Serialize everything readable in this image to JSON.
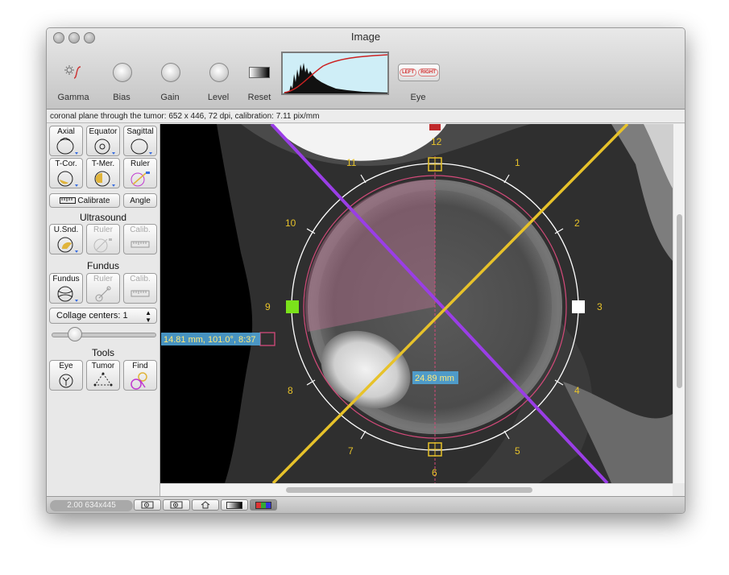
{
  "window": {
    "title": "Image"
  },
  "toolbar": {
    "gamma_label": "Gamma",
    "bias_label": "Bias",
    "gain_label": "Gain",
    "level_label": "Level",
    "reset_label": "Reset",
    "eye_label": "Eye",
    "eye_left": "LEFT",
    "eye_right": "RIGHT"
  },
  "info": {
    "text": "coronal plane through the tumor: 652 x 446, 72 dpi, calibration: 7.11 pix/mm"
  },
  "sidebar": {
    "axial": "Axial",
    "equator": "Equator",
    "sagittal": "Sagittal",
    "tcor": "T-Cor.",
    "tmer": "T-Mer.",
    "ruler": "Ruler",
    "calibrate": "Calibrate",
    "angle": "Angle",
    "ultrasound_heading": "Ultrasound",
    "usnd": "U.Snd.",
    "us_ruler": "Ruler",
    "us_calib": "Calib.",
    "fundus_heading": "Fundus",
    "fundus": "Fundus",
    "fundus_ruler": "Ruler",
    "fundus_calib": "Calib.",
    "collage_label": "Collage centers: 1",
    "collage_slider_value": 0.2,
    "tools_heading": "Tools",
    "eye_tool": "Eye",
    "tumor_tool": "Tumor",
    "find_tool": "Find"
  },
  "overlay": {
    "clock": [
      "12",
      "1",
      "2",
      "3",
      "4",
      "5",
      "6",
      "7",
      "8",
      "9",
      "10",
      "11"
    ],
    "measure_label": "14.81 mm, 101.0°, 8:37",
    "diameter_label": "24.89 mm"
  },
  "status": {
    "zoom": "2.00 634x445"
  },
  "colors": {
    "accent_yellow": "#e7c22a",
    "accent_purple": "#9a3ee6",
    "label_bg": "#4fa3d6",
    "marker_green": "#7be21b"
  }
}
